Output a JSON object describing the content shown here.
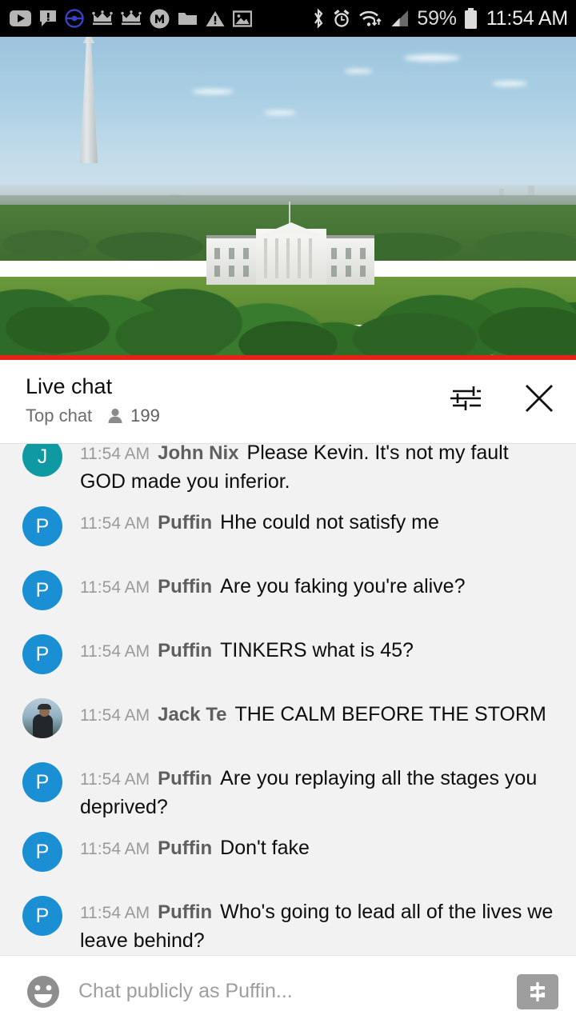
{
  "status_bar": {
    "notification_icons": [
      {
        "name": "youtube-icon",
        "label": "YouTube"
      },
      {
        "name": "message-alert-icon",
        "label": "Message alert"
      },
      {
        "name": "pokeball-icon",
        "label": "Pokemon Go"
      },
      {
        "name": "crown-icon-1",
        "label": "Crown"
      },
      {
        "name": "crown-icon-2",
        "label": "Crown"
      },
      {
        "name": "messenger-icon",
        "label": "Messenger"
      },
      {
        "name": "folder-icon",
        "label": "Folder"
      },
      {
        "name": "warning-icon",
        "label": "Warning"
      },
      {
        "name": "image-icon",
        "label": "Image"
      }
    ],
    "system_icons": [
      {
        "name": "bluetooth-icon",
        "label": "Bluetooth"
      },
      {
        "name": "alarm-icon",
        "label": "Alarm"
      },
      {
        "name": "wifi-icon",
        "label": "Wi-Fi"
      },
      {
        "name": "signal-icon",
        "label": "Cellular signal"
      }
    ],
    "battery_percent": "59%",
    "clock": "11:54 AM",
    "background_color": "#000000",
    "icon_color": "#b6b6b6"
  },
  "video": {
    "scene_description": "White House with Washington Monument",
    "progress_percent": 100,
    "progress_color": "#e62117",
    "progress_track_color": "#b01c1c"
  },
  "chat_header": {
    "title": "Live chat",
    "subtitle": "Top chat",
    "viewer_count": "199",
    "person_icon": "person-icon",
    "settings_icon": "tune-sliders-icon",
    "close_icon": "close-icon"
  },
  "messages": [
    {
      "time": "11:54 AM",
      "author": "John Nix",
      "text": "Please Kevin. It's not my fault GOD made you inferior.",
      "avatar_letter": "J",
      "avatar_color": "#0f9aa3",
      "avatar_type": "letter",
      "clipped": true
    },
    {
      "time": "11:54 AM",
      "author": "Puffin",
      "text": "Hhe could not satisfy me",
      "avatar_letter": "P",
      "avatar_color": "#1a8fd4",
      "avatar_type": "letter",
      "clipped": false
    },
    {
      "time": "11:54 AM",
      "author": "Puffin",
      "text": "Are you faking you're alive?",
      "avatar_letter": "P",
      "avatar_color": "#1a8fd4",
      "avatar_type": "letter",
      "clipped": false
    },
    {
      "time": "11:54 AM",
      "author": "Puffin",
      "text": "TINKERS what is 45?",
      "avatar_letter": "P",
      "avatar_color": "#1a8fd4",
      "avatar_type": "letter",
      "clipped": false
    },
    {
      "time": "11:54 AM",
      "author": "Jack Te",
      "text": "THE CALM BEFORE THE STORM",
      "avatar_letter": "",
      "avatar_color": "#8fa7b8",
      "avatar_type": "photo",
      "clipped": false
    },
    {
      "time": "11:54 AM",
      "author": "Puffin",
      "text": "Are you replaying all the stages you deprived?",
      "avatar_letter": "P",
      "avatar_color": "#1a8fd4",
      "avatar_type": "letter",
      "clipped": false
    },
    {
      "time": "11:54 AM",
      "author": "Puffin",
      "text": "Don't fake",
      "avatar_letter": "P",
      "avatar_color": "#1a8fd4",
      "avatar_type": "letter",
      "clipped": false
    },
    {
      "time": "11:54 AM",
      "author": "Puffin",
      "text": "Who's going to lead all of the lives we leave behind?",
      "avatar_letter": "P",
      "avatar_color": "#1a8fd4",
      "avatar_type": "letter",
      "clipped": false
    }
  ],
  "input_bar": {
    "placeholder": "Chat publicly as Puffin...",
    "value": "",
    "emoji_icon": "emoji-smiley-icon",
    "super_chat_icon": "dollar-sign-icon"
  },
  "colors": {
    "chat_background": "#f2f2f2",
    "panel_background": "#ffffff",
    "accent_red": "#e62117",
    "avatar_blue": "#1a8fd4",
    "avatar_teal": "#0f9aa3"
  }
}
